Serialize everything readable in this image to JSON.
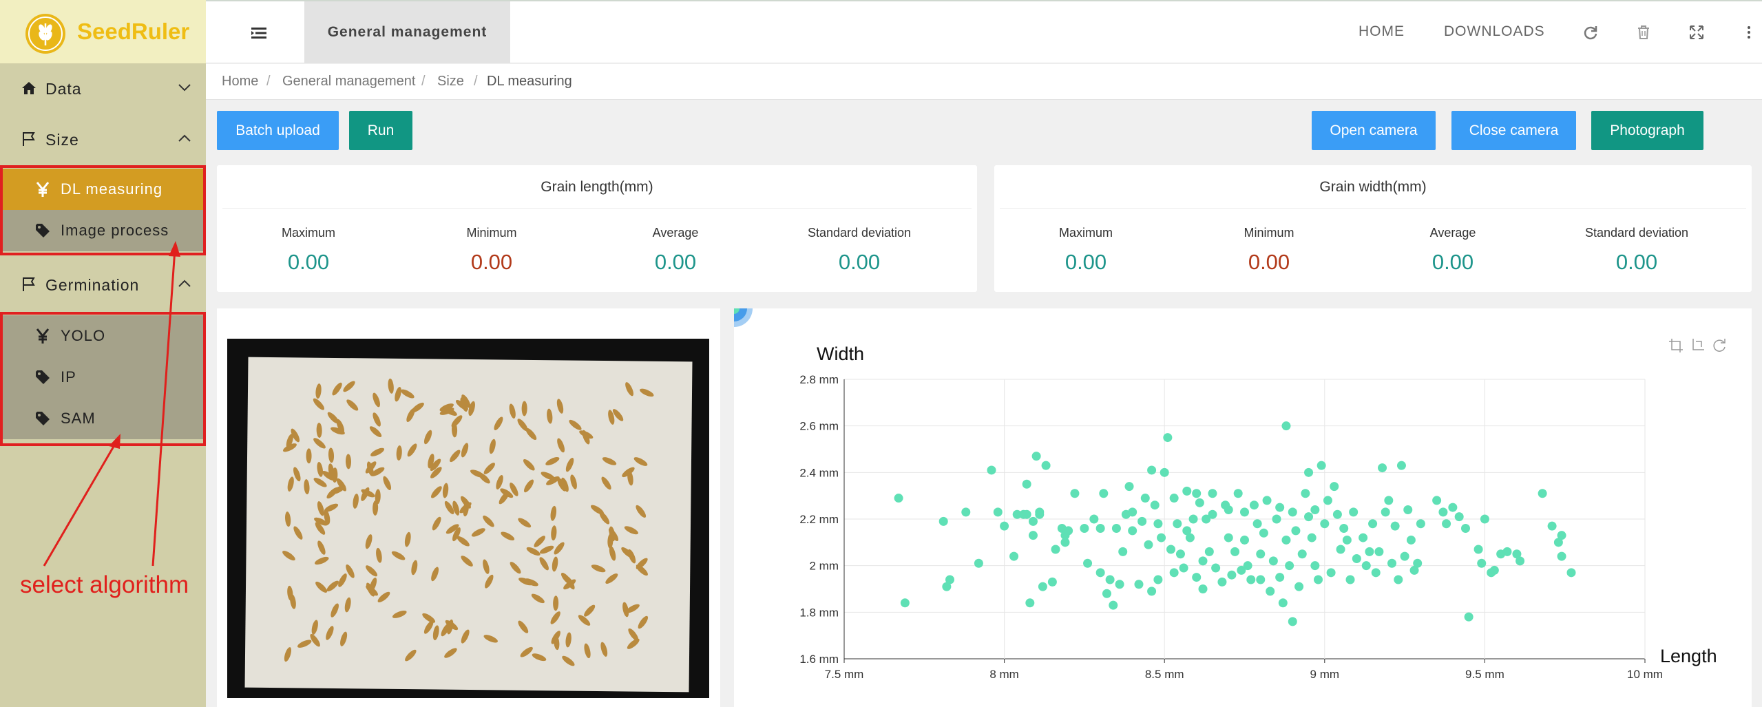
{
  "app": {
    "name": "SeedRuler"
  },
  "sidebar": {
    "groups": [
      {
        "label": "Data",
        "icon": "home-icon",
        "expanded": false
      },
      {
        "label": "Size",
        "icon": "flag-icon",
        "expanded": true,
        "items": [
          {
            "label": "DL measuring",
            "icon": "yen-icon",
            "active": true
          },
          {
            "label": "Image process",
            "icon": "tag-icon"
          }
        ]
      },
      {
        "label": "Germination",
        "icon": "flag-icon",
        "expanded": true,
        "items": [
          {
            "label": "YOLO",
            "icon": "yen-icon"
          },
          {
            "label": "IP",
            "icon": "tag-icon"
          },
          {
            "label": "SAM",
            "icon": "tag-icon"
          }
        ]
      }
    ],
    "annotation": "select algorithm"
  },
  "header": {
    "tab": "General management",
    "nav": [
      "HOME",
      "DOWNLOADS"
    ],
    "icons": [
      "refresh-icon",
      "trash-icon",
      "fullscreen-icon",
      "more-vertical-icon"
    ]
  },
  "breadcrumb": [
    "Home",
    "General management",
    "Size",
    "DL measuring"
  ],
  "toolbar": {
    "batch_upload": "Batch upload",
    "run": "Run",
    "open_camera": "Open camera",
    "close_camera": "Close camera",
    "photograph": "Photograph"
  },
  "colors": {
    "accent": "#3a9df6",
    "teal": "#119683",
    "active_menu": "#d39c22",
    "value_teal": "#1e958b",
    "value_red": "#b23a1a",
    "scatter": "#5fe0b5"
  },
  "length_stats": {
    "title": "Grain length(mm)",
    "items": [
      {
        "label": "Maximum",
        "value": "0.00"
      },
      {
        "label": "Minimum",
        "value": "0.00"
      },
      {
        "label": "Average",
        "value": "0.00"
      },
      {
        "label": "Standard deviation",
        "value": "0.00"
      }
    ]
  },
  "width_stats": {
    "title": "Grain width(mm)",
    "items": [
      {
        "label": "Maximum",
        "value": "0.00"
      },
      {
        "label": "Minimum",
        "value": "0.00"
      },
      {
        "label": "Average",
        "value": "0.00"
      },
      {
        "label": "Standard deviation",
        "value": "0.00"
      }
    ]
  },
  "chart_toolbox": [
    "zoom-icon",
    "zoom-reset-icon",
    "restore-icon"
  ],
  "chart_data": {
    "type": "scatter",
    "xlabel": "Length",
    "ylabel": "Width",
    "xlim": [
      7.5,
      10
    ],
    "ylim": [
      1.6,
      2.8
    ],
    "xticks": [
      "7.5 mm",
      "8 mm",
      "8.5 mm",
      "9 mm",
      "9.5 mm",
      "10 mm"
    ],
    "yticks": [
      "1.6 mm",
      "1.8 mm",
      "2 mm",
      "2.2 mm",
      "2.4 mm",
      "2.6 mm",
      "2.8 mm"
    ],
    "grid": true,
    "highlighted": [
      {
        "x": 7.62,
        "y": 2.33
      },
      {
        "x": 9.76,
        "y": 1.95
      }
    ],
    "points": [
      [
        7.67,
        2.29
      ],
      [
        7.69,
        1.84
      ],
      [
        7.81,
        2.19
      ],
      [
        7.82,
        1.91
      ],
      [
        7.83,
        1.94
      ],
      [
        7.88,
        2.23
      ],
      [
        7.92,
        2.01
      ],
      [
        7.96,
        2.41
      ],
      [
        7.98,
        2.23
      ],
      [
        8.0,
        2.17
      ],
      [
        8.03,
        2.04
      ],
      [
        8.04,
        2.22
      ],
      [
        8.06,
        2.22
      ],
      [
        8.07,
        2.35
      ],
      [
        8.07,
        2.22
      ],
      [
        8.08,
        1.84
      ],
      [
        8.09,
        2.13
      ],
      [
        8.09,
        2.19
      ],
      [
        8.1,
        2.47
      ],
      [
        8.11,
        2.23
      ],
      [
        8.11,
        2.22
      ],
      [
        8.12,
        1.91
      ],
      [
        8.13,
        2.43
      ],
      [
        8.15,
        1.93
      ],
      [
        8.16,
        2.07
      ],
      [
        8.18,
        2.16
      ],
      [
        8.19,
        2.13
      ],
      [
        8.19,
        2.1
      ],
      [
        8.2,
        2.15
      ],
      [
        8.22,
        2.31
      ],
      [
        8.25,
        2.16
      ],
      [
        8.26,
        2.01
      ],
      [
        8.28,
        2.2
      ],
      [
        8.3,
        2.16
      ],
      [
        8.3,
        1.97
      ],
      [
        8.31,
        2.31
      ],
      [
        8.32,
        1.88
      ],
      [
        8.33,
        1.94
      ],
      [
        8.34,
        1.83
      ],
      [
        8.35,
        2.16
      ],
      [
        8.36,
        1.92
      ],
      [
        8.37,
        2.06
      ],
      [
        8.38,
        2.22
      ],
      [
        8.39,
        2.34
      ],
      [
        8.4,
        2.23
      ],
      [
        8.4,
        2.15
      ],
      [
        8.42,
        1.92
      ],
      [
        8.43,
        2.19
      ],
      [
        8.44,
        2.29
      ],
      [
        8.45,
        2.09
      ],
      [
        8.46,
        1.89
      ],
      [
        8.46,
        2.41
      ],
      [
        8.47,
        2.26
      ],
      [
        8.48,
        2.18
      ],
      [
        8.48,
        1.94
      ],
      [
        8.49,
        2.12
      ],
      [
        8.5,
        2.4
      ],
      [
        8.51,
        2.55
      ],
      [
        8.52,
        2.07
      ],
      [
        8.53,
        1.97
      ],
      [
        8.53,
        2.29
      ],
      [
        8.54,
        2.18
      ],
      [
        8.55,
        2.05
      ],
      [
        8.56,
        1.99
      ],
      [
        8.57,
        2.32
      ],
      [
        8.57,
        2.15
      ],
      [
        8.58,
        2.12
      ],
      [
        8.59,
        2.2
      ],
      [
        8.6,
        1.95
      ],
      [
        8.61,
        2.27
      ],
      [
        8.62,
        2.02
      ],
      [
        8.62,
        1.9
      ],
      [
        8.63,
        2.2
      ],
      [
        8.64,
        2.06
      ],
      [
        8.65,
        2.31
      ],
      [
        8.65,
        2.22
      ],
      [
        8.66,
        1.99
      ],
      [
        8.68,
        1.93
      ],
      [
        8.69,
        2.26
      ],
      [
        8.7,
        2.12
      ],
      [
        8.71,
        1.96
      ],
      [
        8.72,
        2.06
      ],
      [
        8.73,
        2.31
      ],
      [
        8.74,
        1.98
      ],
      [
        8.75,
        2.23
      ],
      [
        8.75,
        2.11
      ],
      [
        8.76,
        2.0
      ],
      [
        8.77,
        1.94
      ],
      [
        8.78,
        2.26
      ],
      [
        8.79,
        2.18
      ],
      [
        8.8,
        1.94
      ],
      [
        8.8,
        2.05
      ],
      [
        8.81,
        2.14
      ],
      [
        8.82,
        2.28
      ],
      [
        8.83,
        1.89
      ],
      [
        8.84,
        2.02
      ],
      [
        8.85,
        2.2
      ],
      [
        8.86,
        2.25
      ],
      [
        8.86,
        1.95
      ],
      [
        8.87,
        1.84
      ],
      [
        8.88,
        2.6
      ],
      [
        8.88,
        2.11
      ],
      [
        8.89,
        2.0
      ],
      [
        8.9,
        1.76
      ],
      [
        8.9,
        2.23
      ],
      [
        8.91,
        2.15
      ],
      [
        8.92,
        1.91
      ],
      [
        8.93,
        2.05
      ],
      [
        8.94,
        2.31
      ],
      [
        8.95,
        2.21
      ],
      [
        8.95,
        2.4
      ],
      [
        8.96,
        2.12
      ],
      [
        8.97,
        2.0
      ],
      [
        8.98,
        1.94
      ],
      [
        8.99,
        2.43
      ],
      [
        9.0,
        2.18
      ],
      [
        9.01,
        2.28
      ],
      [
        9.02,
        1.97
      ],
      [
        9.03,
        2.34
      ],
      [
        9.04,
        2.22
      ],
      [
        9.05,
        2.07
      ],
      [
        9.06,
        2.16
      ],
      [
        9.07,
        2.11
      ],
      [
        9.08,
        1.94
      ],
      [
        9.09,
        2.23
      ],
      [
        9.1,
        2.03
      ],
      [
        9.12,
        2.12
      ],
      [
        9.13,
        2.0
      ],
      [
        9.14,
        2.06
      ],
      [
        9.15,
        2.18
      ],
      [
        9.16,
        1.97
      ],
      [
        9.17,
        2.06
      ],
      [
        9.18,
        2.42
      ],
      [
        9.19,
        2.23
      ],
      [
        9.2,
        2.28
      ],
      [
        9.21,
        2.01
      ],
      [
        9.22,
        2.17
      ],
      [
        9.23,
        1.94
      ],
      [
        9.24,
        2.43
      ],
      [
        9.25,
        2.04
      ],
      [
        9.26,
        2.24
      ],
      [
        9.27,
        2.11
      ],
      [
        9.28,
        1.98
      ],
      [
        9.29,
        2.01
      ],
      [
        9.3,
        2.18
      ],
      [
        9.35,
        2.28
      ],
      [
        9.37,
        2.23
      ],
      [
        9.38,
        2.18
      ],
      [
        9.4,
        2.25
      ],
      [
        9.42,
        2.21
      ],
      [
        9.44,
        2.16
      ],
      [
        9.45,
        1.78
      ],
      [
        9.48,
        2.07
      ],
      [
        9.49,
        2.01
      ],
      [
        9.5,
        2.2
      ],
      [
        9.52,
        1.97
      ],
      [
        9.53,
        1.98
      ],
      [
        9.55,
        2.05
      ],
      [
        9.57,
        2.06
      ],
      [
        9.6,
        2.05
      ],
      [
        9.61,
        2.02
      ],
      [
        9.68,
        2.31
      ],
      [
        9.71,
        2.17
      ],
      [
        9.73,
        2.1
      ],
      [
        9.74,
        2.13
      ],
      [
        9.74,
        2.04
      ],
      [
        9.77,
        1.97
      ],
      [
        8.97,
        2.24
      ],
      [
        8.6,
        2.31
      ],
      [
        8.7,
        2.24
      ]
    ]
  }
}
